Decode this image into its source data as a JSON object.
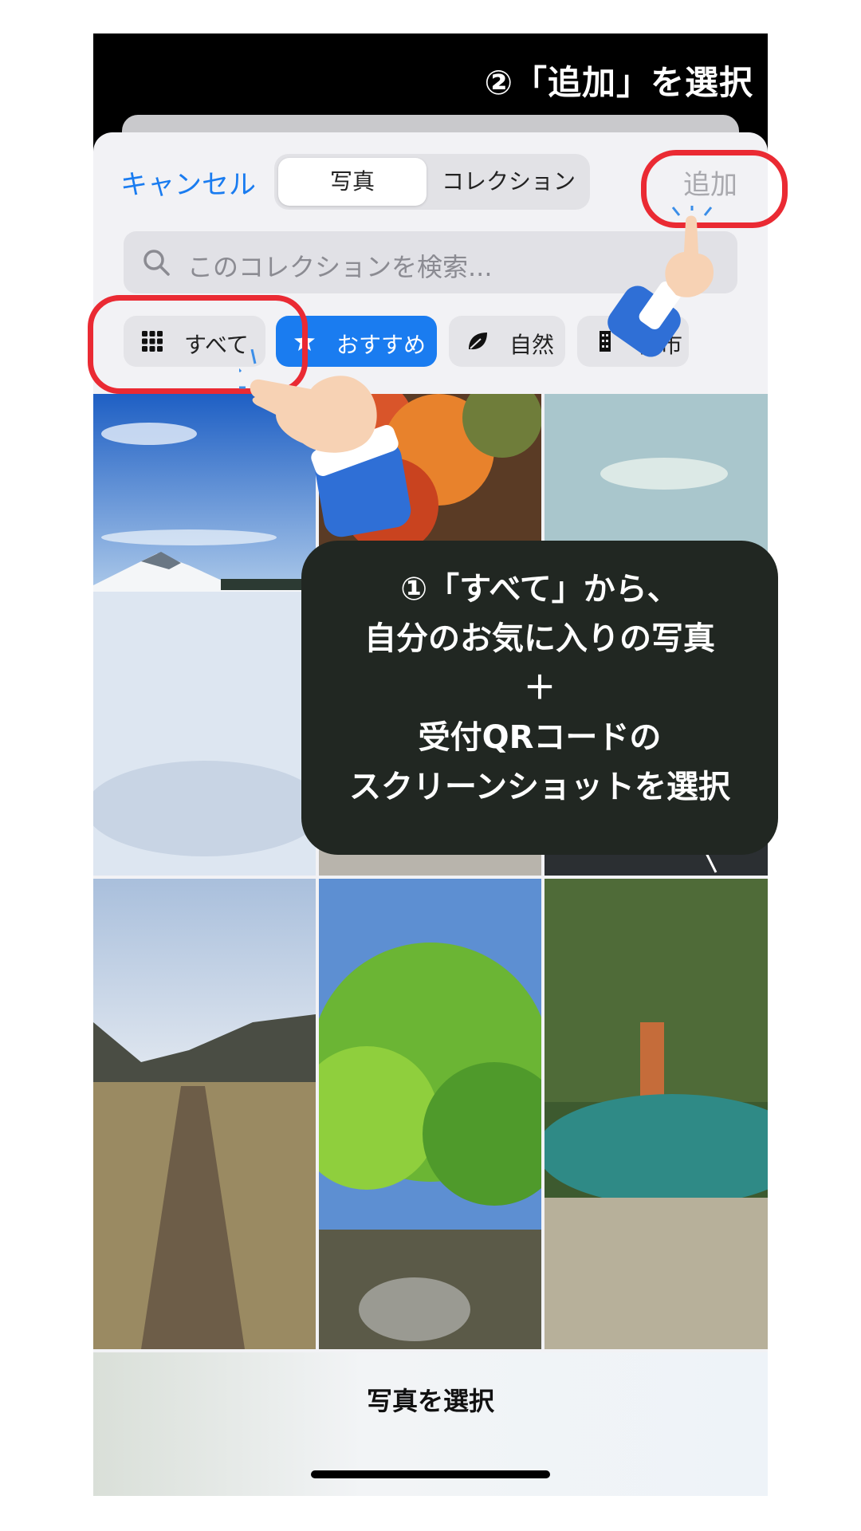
{
  "annotation": {
    "step2": "②「追加」を選択",
    "step1_lines": [
      "①「すべて」から、",
      "自分のお気に入りの写真",
      "＋",
      "受付QRコードの",
      "スクリーンショットを選択"
    ]
  },
  "sheet": {
    "cancel": "キャンセル",
    "tabs": [
      "写真",
      "コレクション"
    ],
    "add": "追加",
    "search_placeholder": "このコレクションを検索...",
    "chips": [
      "すべて",
      "おすすめ",
      "自然",
      "都市"
    ],
    "bottom_title": "写真を選択"
  },
  "colors": {
    "accent": "#1a7cf0",
    "highlight_ring": "#ea2a33",
    "callout_bg": "#212722"
  }
}
